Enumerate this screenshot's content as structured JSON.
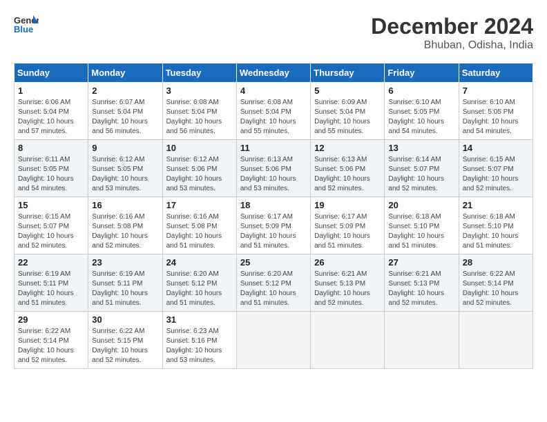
{
  "logo": {
    "line1": "General",
    "line2": "Blue"
  },
  "title": "December 2024",
  "subtitle": "Bhuban, Odisha, India",
  "days_of_week": [
    "Sunday",
    "Monday",
    "Tuesday",
    "Wednesday",
    "Thursday",
    "Friday",
    "Saturday"
  ],
  "weeks": [
    [
      {
        "day": 1,
        "sunrise": "6:06 AM",
        "sunset": "5:04 PM",
        "daylight": "10 hours and 57 minutes."
      },
      {
        "day": 2,
        "sunrise": "6:07 AM",
        "sunset": "5:04 PM",
        "daylight": "10 hours and 56 minutes."
      },
      {
        "day": 3,
        "sunrise": "6:08 AM",
        "sunset": "5:04 PM",
        "daylight": "10 hours and 56 minutes."
      },
      {
        "day": 4,
        "sunrise": "6:08 AM",
        "sunset": "5:04 PM",
        "daylight": "10 hours and 55 minutes."
      },
      {
        "day": 5,
        "sunrise": "6:09 AM",
        "sunset": "5:04 PM",
        "daylight": "10 hours and 55 minutes."
      },
      {
        "day": 6,
        "sunrise": "6:10 AM",
        "sunset": "5:05 PM",
        "daylight": "10 hours and 54 minutes."
      },
      {
        "day": 7,
        "sunrise": "6:10 AM",
        "sunset": "5:05 PM",
        "daylight": "10 hours and 54 minutes."
      }
    ],
    [
      {
        "day": 8,
        "sunrise": "6:11 AM",
        "sunset": "5:05 PM",
        "daylight": "10 hours and 54 minutes."
      },
      {
        "day": 9,
        "sunrise": "6:12 AM",
        "sunset": "5:05 PM",
        "daylight": "10 hours and 53 minutes."
      },
      {
        "day": 10,
        "sunrise": "6:12 AM",
        "sunset": "5:06 PM",
        "daylight": "10 hours and 53 minutes."
      },
      {
        "day": 11,
        "sunrise": "6:13 AM",
        "sunset": "5:06 PM",
        "daylight": "10 hours and 53 minutes."
      },
      {
        "day": 12,
        "sunrise": "6:13 AM",
        "sunset": "5:06 PM",
        "daylight": "10 hours and 52 minutes."
      },
      {
        "day": 13,
        "sunrise": "6:14 AM",
        "sunset": "5:07 PM",
        "daylight": "10 hours and 52 minutes."
      },
      {
        "day": 14,
        "sunrise": "6:15 AM",
        "sunset": "5:07 PM",
        "daylight": "10 hours and 52 minutes."
      }
    ],
    [
      {
        "day": 15,
        "sunrise": "6:15 AM",
        "sunset": "5:07 PM",
        "daylight": "10 hours and 52 minutes."
      },
      {
        "day": 16,
        "sunrise": "6:16 AM",
        "sunset": "5:08 PM",
        "daylight": "10 hours and 52 minutes."
      },
      {
        "day": 17,
        "sunrise": "6:16 AM",
        "sunset": "5:08 PM",
        "daylight": "10 hours and 51 minutes."
      },
      {
        "day": 18,
        "sunrise": "6:17 AM",
        "sunset": "5:09 PM",
        "daylight": "10 hours and 51 minutes."
      },
      {
        "day": 19,
        "sunrise": "6:17 AM",
        "sunset": "5:09 PM",
        "daylight": "10 hours and 51 minutes."
      },
      {
        "day": 20,
        "sunrise": "6:18 AM",
        "sunset": "5:10 PM",
        "daylight": "10 hours and 51 minutes."
      },
      {
        "day": 21,
        "sunrise": "6:18 AM",
        "sunset": "5:10 PM",
        "daylight": "10 hours and 51 minutes."
      }
    ],
    [
      {
        "day": 22,
        "sunrise": "6:19 AM",
        "sunset": "5:11 PM",
        "daylight": "10 hours and 51 minutes."
      },
      {
        "day": 23,
        "sunrise": "6:19 AM",
        "sunset": "5:11 PM",
        "daylight": "10 hours and 51 minutes."
      },
      {
        "day": 24,
        "sunrise": "6:20 AM",
        "sunset": "5:12 PM",
        "daylight": "10 hours and 51 minutes."
      },
      {
        "day": 25,
        "sunrise": "6:20 AM",
        "sunset": "5:12 PM",
        "daylight": "10 hours and 51 minutes."
      },
      {
        "day": 26,
        "sunrise": "6:21 AM",
        "sunset": "5:13 PM",
        "daylight": "10 hours and 52 minutes."
      },
      {
        "day": 27,
        "sunrise": "6:21 AM",
        "sunset": "5:13 PM",
        "daylight": "10 hours and 52 minutes."
      },
      {
        "day": 28,
        "sunrise": "6:22 AM",
        "sunset": "5:14 PM",
        "daylight": "10 hours and 52 minutes."
      }
    ],
    [
      {
        "day": 29,
        "sunrise": "6:22 AM",
        "sunset": "5:14 PM",
        "daylight": "10 hours and 52 minutes."
      },
      {
        "day": 30,
        "sunrise": "6:22 AM",
        "sunset": "5:15 PM",
        "daylight": "10 hours and 52 minutes."
      },
      {
        "day": 31,
        "sunrise": "6:23 AM",
        "sunset": "5:16 PM",
        "daylight": "10 hours and 53 minutes."
      },
      null,
      null,
      null,
      null
    ]
  ]
}
